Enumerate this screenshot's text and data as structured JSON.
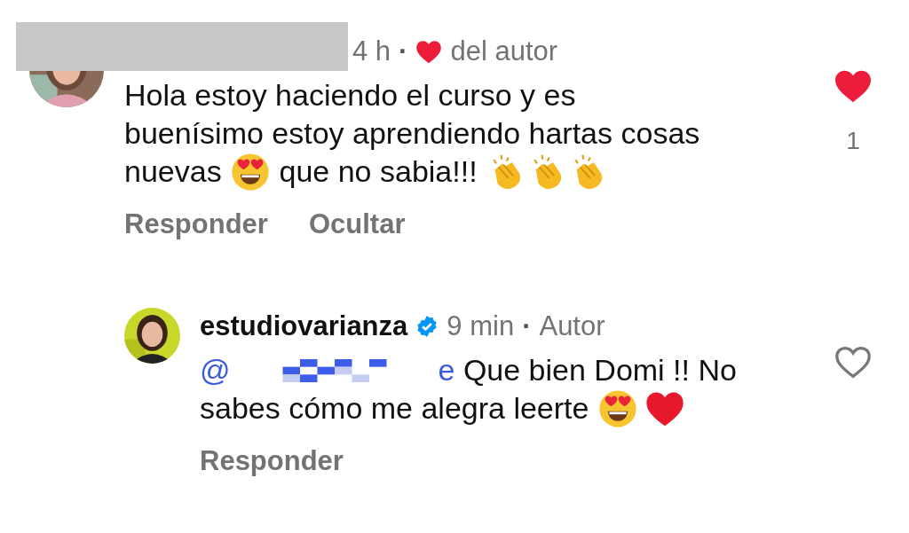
{
  "comments": [
    {
      "redacted": true,
      "reply": false,
      "liked": true,
      "like_count": "1",
      "meta": [
        {
          "kind": "text",
          "text": "4 h"
        },
        {
          "kind": "dot",
          "text": "·"
        },
        {
          "kind": "heart"
        },
        {
          "kind": "text",
          "text": "del autor"
        }
      ],
      "lines": [
        [
          {
            "kind": "text",
            "text": "Hola estoy haciendo el curso y es"
          }
        ],
        [
          {
            "kind": "text",
            "text": "buenísimo estoy aprendiendo hartas cosas"
          }
        ],
        [
          {
            "kind": "text",
            "text": "nuevas "
          },
          {
            "kind": "heart_eyes"
          },
          {
            "kind": "text",
            "text": " que no sabia!!! "
          },
          {
            "kind": "clap"
          },
          {
            "kind": "clap"
          },
          {
            "kind": "clap"
          }
        ]
      ],
      "actions": [
        "Responder",
        "Ocultar"
      ]
    },
    {
      "username": "estudiovarianza",
      "verified": true,
      "reply": true,
      "liked": false,
      "meta": [
        {
          "kind": "text",
          "text": "9 min"
        },
        {
          "kind": "dot",
          "text": "·"
        },
        {
          "kind": "text",
          "text": "Autor"
        }
      ],
      "lines": [
        [
          {
            "kind": "mention_start",
            "text": "@"
          },
          {
            "kind": "pixelated"
          },
          {
            "kind": "mention_end",
            "text": "e"
          },
          {
            "kind": "text",
            "text": " Que bien Domi !! No"
          }
        ],
        [
          {
            "kind": "text",
            "text": "sabes cómo me alegra leerte "
          },
          {
            "kind": "heart_eyes"
          },
          {
            "kind": "heart"
          }
        ]
      ],
      "actions": [
        "Responder"
      ]
    }
  ]
}
